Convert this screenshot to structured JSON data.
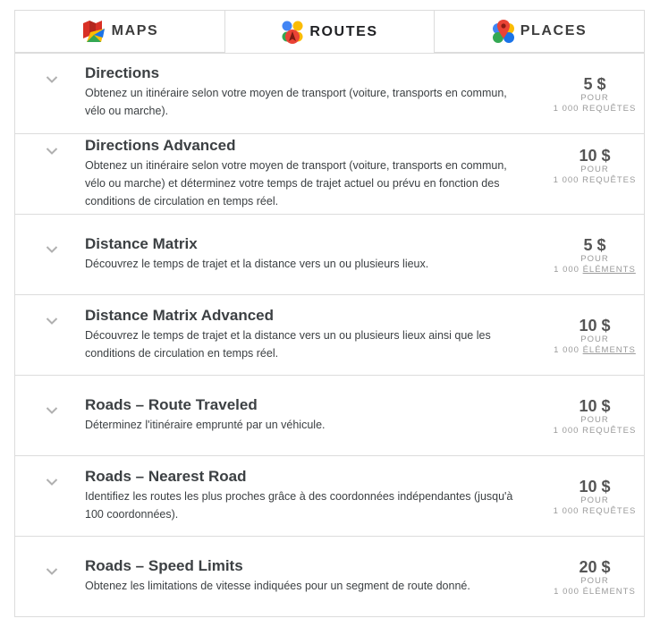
{
  "tabs": [
    {
      "label": "MAPS",
      "icon": "maps-icon",
      "active": false
    },
    {
      "label": "ROUTES",
      "icon": "routes-icon",
      "active": true
    },
    {
      "label": "PLACES",
      "icon": "places-icon",
      "active": false
    }
  ],
  "products": [
    {
      "title": "Directions",
      "description": "Obtenez un itinéraire selon votre moyen de transport (voiture, transports en commun, vélo ou marche).",
      "price": "5 $",
      "per": "POUR",
      "quantity": "1 000",
      "unit": "REQUÊTES",
      "unit_is_link": false
    },
    {
      "title": "Directions Advanced",
      "description": "Obtenez un itinéraire selon votre moyen de transport (voiture, transports en commun, vélo ou marche) et déterminez votre temps de trajet actuel ou prévu en fonction des conditions de circulation en temps réel.",
      "price": "10 $",
      "per": "POUR",
      "quantity": "1 000",
      "unit": "REQUÊTES",
      "unit_is_link": false
    },
    {
      "title": "Distance Matrix",
      "description": "Découvrez le temps de trajet et la distance vers un ou plusieurs lieux.",
      "price": "5 $",
      "per": "POUR",
      "quantity": "1 000",
      "unit": "ÉLÉMENTS",
      "unit_is_link": true
    },
    {
      "title": "Distance Matrix Advanced",
      "description": "Découvrez le temps de trajet et la distance vers un ou plusieurs lieux ainsi que les conditions de circulation en temps réel.",
      "price": "10 $",
      "per": "POUR",
      "quantity": "1 000",
      "unit": "ÉLÉMENTS",
      "unit_is_link": true
    },
    {
      "title": "Roads – Route Traveled",
      "description": "Déterminez l'itinéraire emprunté par un véhicule.",
      "price": "10 $",
      "per": "POUR",
      "quantity": "1 000",
      "unit": "REQUÊTES",
      "unit_is_link": false
    },
    {
      "title": "Roads – Nearest Road",
      "description": "Identifiez les routes les plus proches grâce à des coordonnées indépendantes (jusqu'à 100 coordonnées).",
      "price": "10 $",
      "per": "POUR",
      "quantity": "1 000",
      "unit": "REQUÊTES",
      "unit_is_link": false
    },
    {
      "title": "Roads – Speed Limits",
      "description": "Obtenez les limitations de vitesse indiquées pour un segment de route donné.",
      "price": "20 $",
      "per": "POUR",
      "quantity": "1 000",
      "unit": "ÉLÉMENTS",
      "unit_is_link": false
    }
  ],
  "colors": {
    "border": "#dcdcdc",
    "text": "#3c4043",
    "price": "#555555",
    "muted": "#9a9a9a",
    "chevron": "#b0b0b0"
  }
}
